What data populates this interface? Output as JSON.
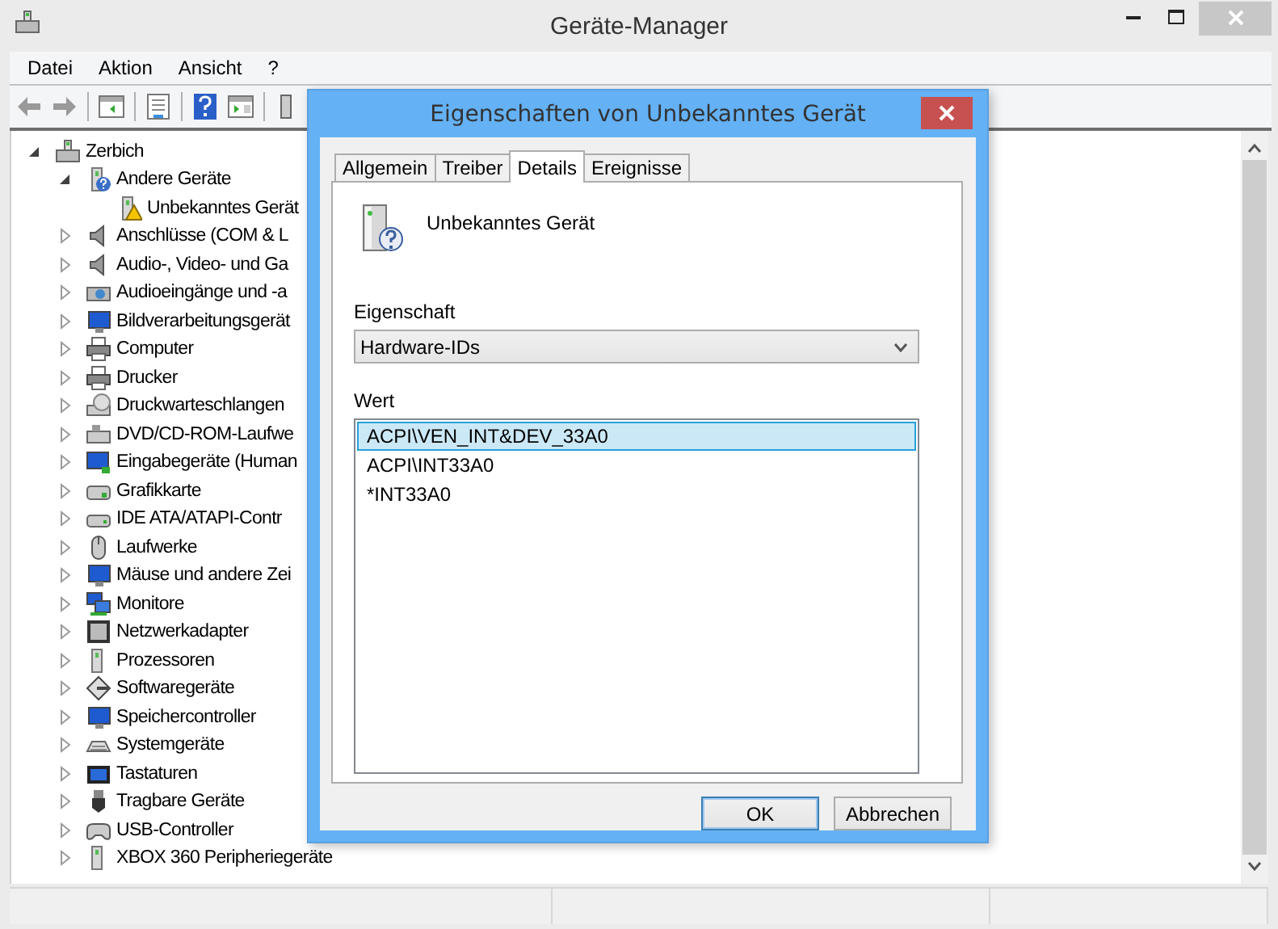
{
  "window": {
    "title": "Geräte-Manager"
  },
  "menu": [
    "Datei",
    "Aktion",
    "Ansicht",
    "?"
  ],
  "tree": [
    {
      "label": "Zerbich",
      "expanded": true,
      "children": [
        {
          "label": "Andere Geräte",
          "expanded": true,
          "children": [
            {
              "label": "Unbekanntes Gerät",
              "warning": true
            }
          ]
        },
        {
          "label": "Anschlüsse (COM & L",
          "expanded": false
        },
        {
          "label": "Audio-, Video- und Ga",
          "expanded": false
        },
        {
          "label": "Audioeingänge und -a",
          "expanded": false
        },
        {
          "label": "Bildverarbeitungsgerät",
          "expanded": false
        },
        {
          "label": "Computer",
          "expanded": false
        },
        {
          "label": "Drucker",
          "expanded": false
        },
        {
          "label": "Druckwarteschlangen",
          "expanded": false
        },
        {
          "label": "DVD/CD-ROM-Laufwe",
          "expanded": false
        },
        {
          "label": "Eingabegeräte (Human",
          "expanded": false
        },
        {
          "label": "Grafikkarte",
          "expanded": false
        },
        {
          "label": "IDE ATA/ATAPI-Contr",
          "expanded": false
        },
        {
          "label": "Laufwerke",
          "expanded": false
        },
        {
          "label": "Mäuse und andere Zei",
          "expanded": false
        },
        {
          "label": "Monitore",
          "expanded": false
        },
        {
          "label": "Netzwerkadapter",
          "expanded": false
        },
        {
          "label": "Prozessoren",
          "expanded": false
        },
        {
          "label": "Softwaregeräte",
          "expanded": false
        },
        {
          "label": "Speichercontroller",
          "expanded": false
        },
        {
          "label": "Systemgeräte",
          "expanded": false
        },
        {
          "label": "Tastaturen",
          "expanded": false
        },
        {
          "label": "Tragbare Geräte",
          "expanded": false
        },
        {
          "label": "USB-Controller",
          "expanded": false
        },
        {
          "label": "XBOX 360 Peripheriegeräte",
          "expanded": false
        }
      ]
    }
  ],
  "dialog": {
    "title": "Eigenschaften von Unbekanntes Gerät",
    "tabs": [
      {
        "label": "Allgemein",
        "selected": false
      },
      {
        "label": "Treiber",
        "selected": false
      },
      {
        "label": "Details",
        "selected": true
      },
      {
        "label": "Ereignisse",
        "selected": false
      }
    ],
    "device_name": "Unbekanntes Gerät",
    "property_label": "Eigenschaft",
    "property_value": "Hardware-IDs",
    "value_label": "Wert",
    "values": [
      {
        "text": "ACPI\\VEN_INT&DEV_33A0",
        "selected": true
      },
      {
        "text": "ACPI\\INT33A0",
        "selected": false
      },
      {
        "text": "*INT33A0",
        "selected": false
      }
    ],
    "buttons": [
      {
        "label": "OK",
        "default": true
      },
      {
        "label": "Abbrechen",
        "default": false
      }
    ]
  }
}
